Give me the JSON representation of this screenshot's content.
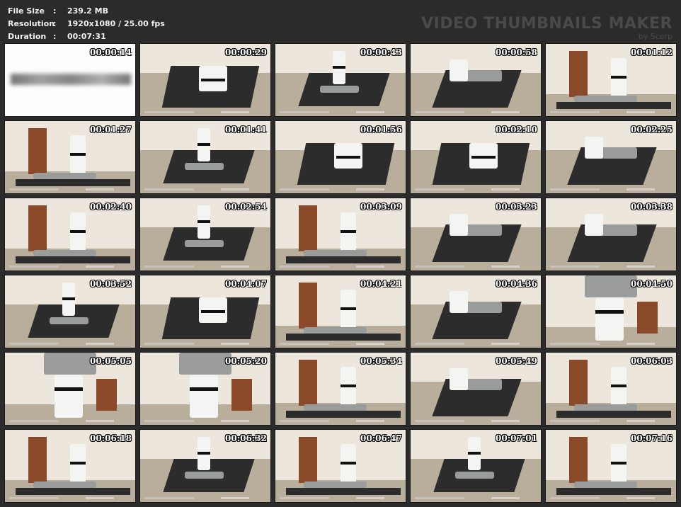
{
  "info": {
    "file_size_label": "File Size",
    "file_size_value": "239.2 MB",
    "resolution_label": "Resolution",
    "resolution_value": "1920x1080 / 25.00 fps",
    "duration_label": "Duration",
    "duration_value": "00:07:31",
    "separator": ":"
  },
  "brand": {
    "title": "VIDEO THUMBNAILS MAKER",
    "subtitle": "by Scorp"
  },
  "thumbnails": [
    {
      "time": "00:00:14",
      "variant": "title"
    },
    {
      "time": "00:00:29",
      "variant": "a"
    },
    {
      "time": "00:00:43",
      "variant": "b"
    },
    {
      "time": "00:00:58",
      "variant": "c"
    },
    {
      "time": "00:01:12",
      "variant": "d"
    },
    {
      "time": "00:01:27",
      "variant": "d"
    },
    {
      "time": "00:01:41",
      "variant": "b"
    },
    {
      "time": "00:01:56",
      "variant": "a"
    },
    {
      "time": "00:02:10",
      "variant": "a"
    },
    {
      "time": "00:02:25",
      "variant": "c"
    },
    {
      "time": "00:02:40",
      "variant": "d"
    },
    {
      "time": "00:02:54",
      "variant": "b"
    },
    {
      "time": "00:03:09",
      "variant": "d"
    },
    {
      "time": "00:03:23",
      "variant": "c"
    },
    {
      "time": "00:03:38",
      "variant": "c"
    },
    {
      "time": "00:03:52",
      "variant": "b"
    },
    {
      "time": "00:04:07",
      "variant": "a"
    },
    {
      "time": "00:04:21",
      "variant": "d"
    },
    {
      "time": "00:04:36",
      "variant": "c"
    },
    {
      "time": "00:04:50",
      "variant": "e"
    },
    {
      "time": "00:05:05",
      "variant": "e"
    },
    {
      "time": "00:05:20",
      "variant": "e"
    },
    {
      "time": "00:05:34",
      "variant": "d"
    },
    {
      "time": "00:05:49",
      "variant": "c"
    },
    {
      "time": "00:06:03",
      "variant": "d"
    },
    {
      "time": "00:06:18",
      "variant": "d"
    },
    {
      "time": "00:06:32",
      "variant": "b"
    },
    {
      "time": "00:06:47",
      "variant": "d"
    },
    {
      "time": "00:07:01",
      "variant": "b"
    },
    {
      "time": "00:07:16",
      "variant": "d"
    }
  ]
}
